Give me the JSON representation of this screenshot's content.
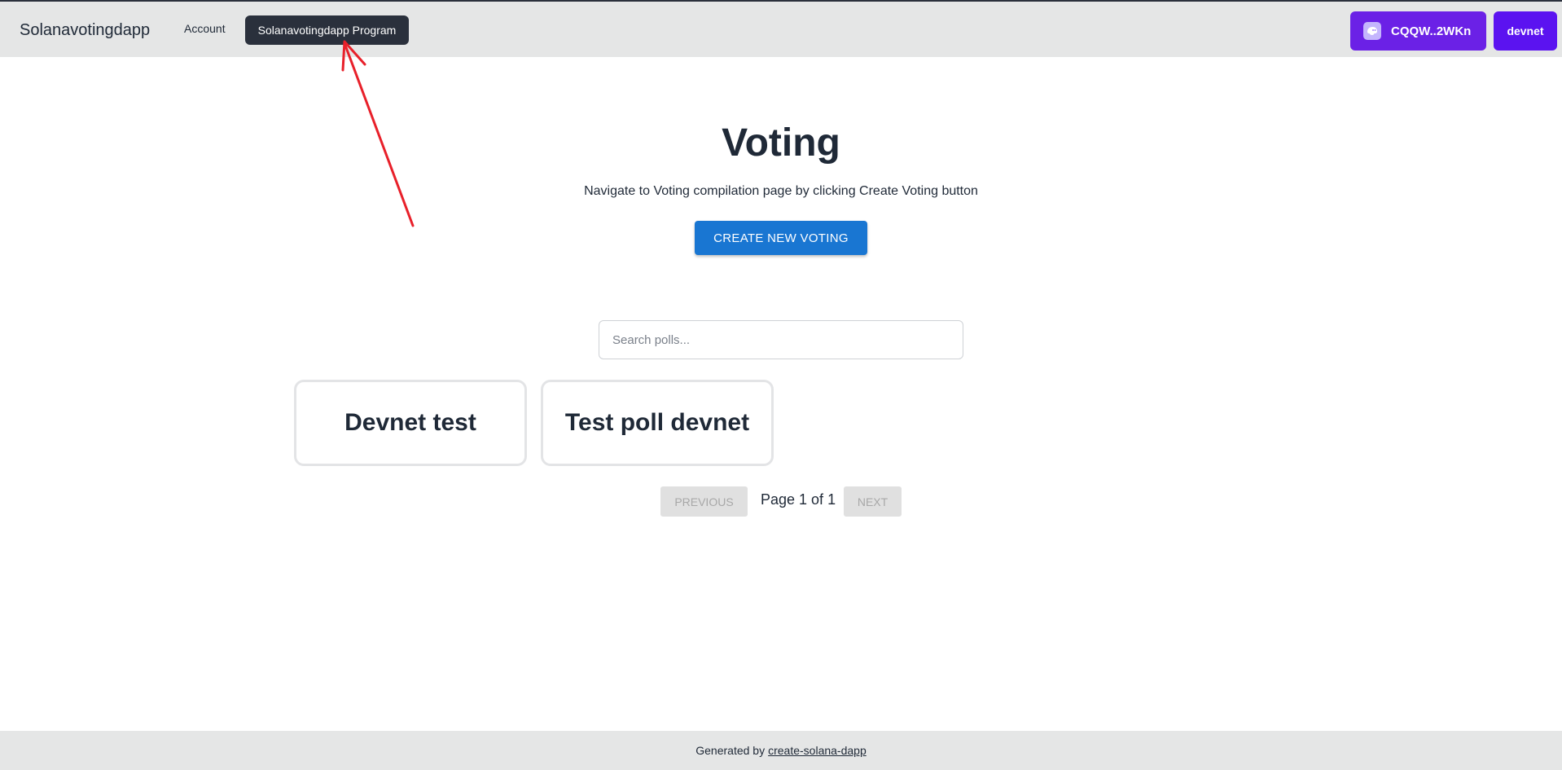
{
  "navbar": {
    "brand": "Solanavotingdapp",
    "links": [
      {
        "label": "Account"
      },
      {
        "label": "Solanavotingdapp Program"
      }
    ],
    "wallet_label": "CQQW..2WKn",
    "cluster_label": "devnet"
  },
  "main": {
    "title": "Voting",
    "subtitle": "Navigate to Voting compilation page by clicking Create Voting button",
    "create_button": "CREATE NEW VOTING",
    "search": {
      "placeholder": "Search polls...",
      "value": ""
    },
    "polls": [
      {
        "title": "Devnet test"
      },
      {
        "title": "Test poll devnet"
      }
    ],
    "pagination": {
      "previous_label": "PREVIOUS",
      "page_text": "Page 1 of 1",
      "next_label": "NEXT"
    }
  },
  "footer": {
    "text": "Generated by",
    "link_label": "create-solana-dapp"
  },
  "colors": {
    "accent": "#1976d2",
    "wallet": "#6b21e6",
    "cluster": "#5b13f0",
    "annotation_arrow": "#e8202a"
  },
  "icons": {
    "wallet": "ghost-icon",
    "annotation": "red-arrow-icon"
  }
}
